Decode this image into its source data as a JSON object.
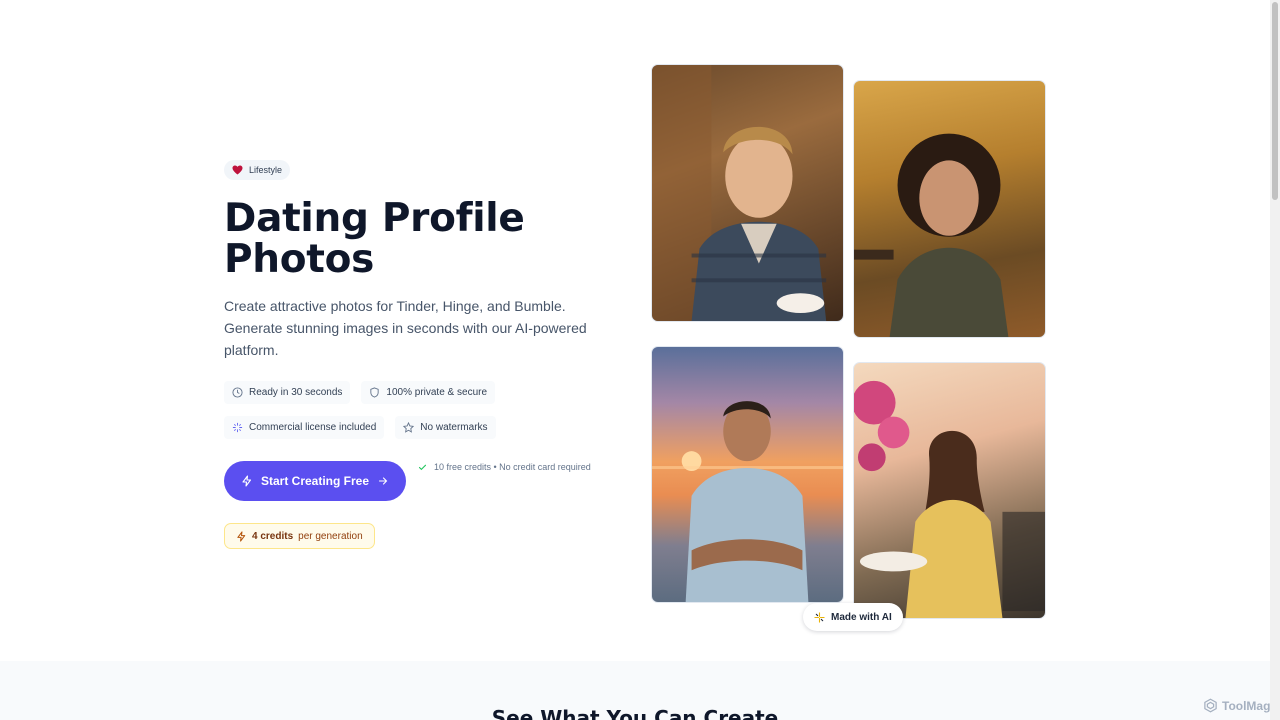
{
  "hero": {
    "tag": {
      "icon": "heart-icon",
      "label": "Lifestyle"
    },
    "title": "Dating Profile Photos",
    "description": "Create attractive photos for Tinder, Hinge, and Bumble. Generate stunning images in seconds with our AI-powered platform.",
    "features": [
      {
        "icon": "clock-icon",
        "label": "Ready in 30 seconds"
      },
      {
        "icon": "shield-icon",
        "label": "100% private & secure"
      },
      {
        "icon": "sparkle-icon",
        "label": "Commercial license included"
      },
      {
        "icon": "star-icon",
        "label": "No watermarks"
      }
    ],
    "cta": {
      "label": "Start Creating Free",
      "icon": "bolt-icon",
      "arrow": "arrow-right-icon"
    },
    "note": "10 free credits • No credit card required",
    "credits": {
      "count": "4 credits",
      "suffix": " per generation"
    }
  },
  "gallery": {
    "badge": "Made with AI"
  },
  "section2": {
    "title": "See What You Can Create"
  },
  "watermark": {
    "label": "ToolMage"
  },
  "colors": {
    "primary": "#5b4ff0",
    "credits_bg": "#fffbeb",
    "credits_border": "#fde68a"
  }
}
